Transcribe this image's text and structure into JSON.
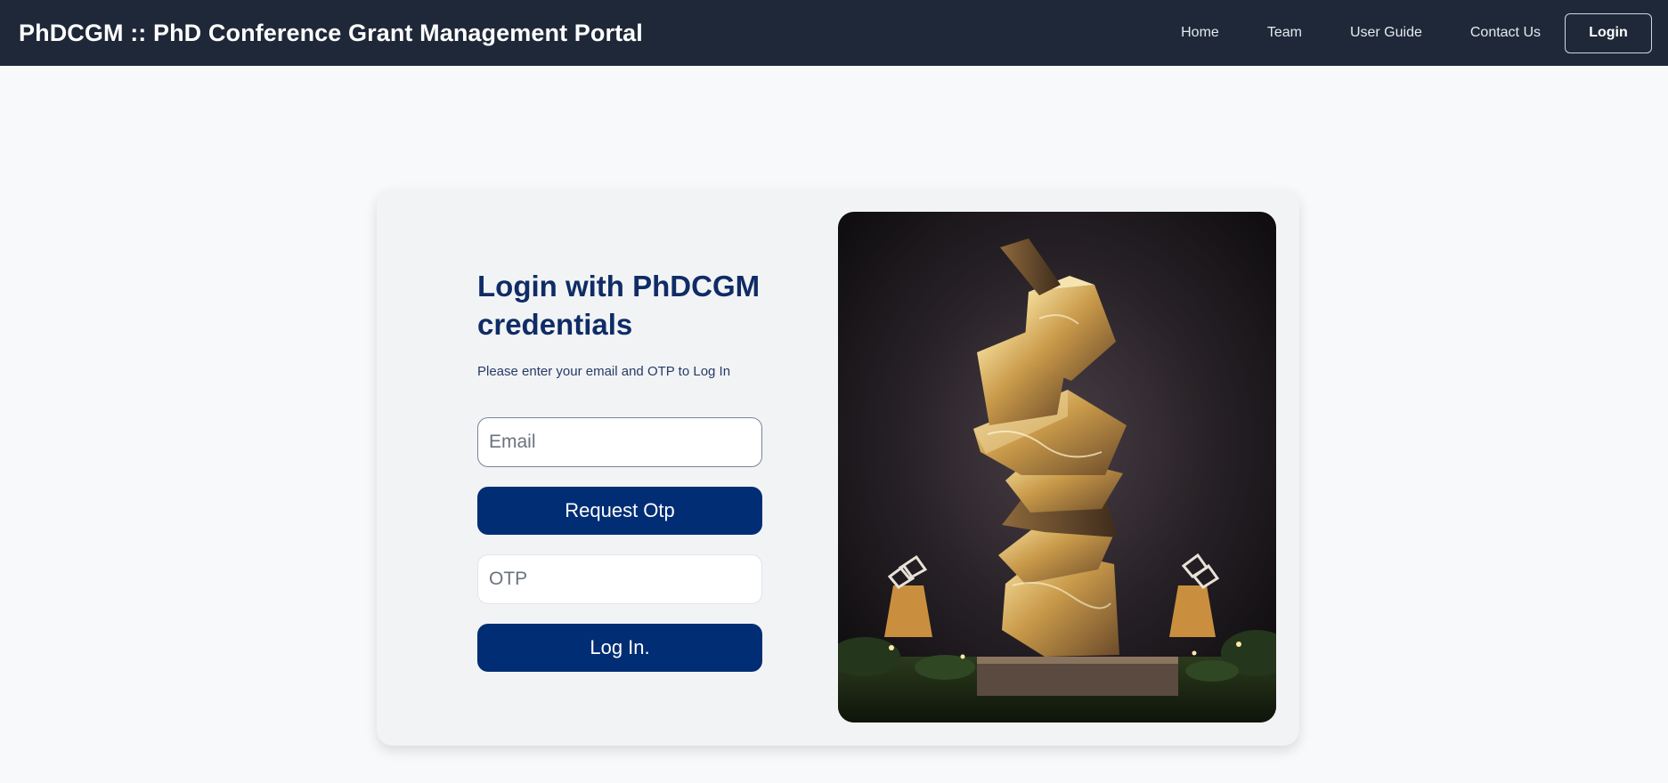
{
  "header": {
    "brand": "PhDCGM :: PhD Conference Grant Management Portal",
    "nav": [
      {
        "label": "Home"
      },
      {
        "label": "Team"
      },
      {
        "label": "User Guide"
      },
      {
        "label": "Contact Us"
      }
    ],
    "login_label": "Login"
  },
  "login": {
    "title": "Login with PhDCGM credentials",
    "subtitle": "Please enter your email and OTP to Log In",
    "email_placeholder": "Email",
    "request_otp_label": "Request Otp",
    "otp_placeholder": "OTP",
    "login_button_label": "Log In."
  },
  "colors": {
    "navbar": "#1e2838",
    "accent": "#002d74",
    "title": "#0f2c66"
  }
}
